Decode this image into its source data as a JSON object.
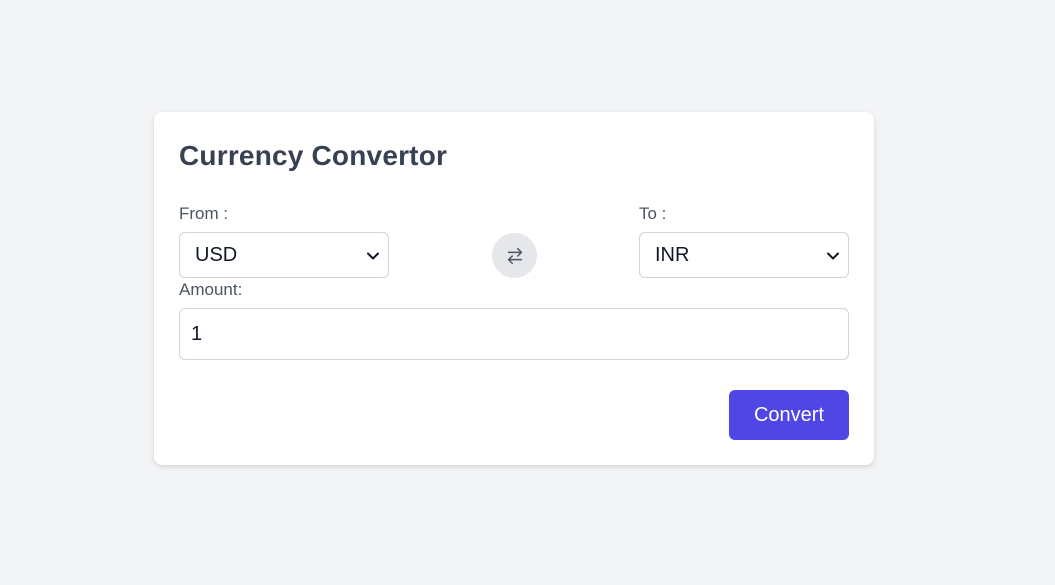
{
  "converter": {
    "title": "Currency Convertor",
    "from_label": "From :",
    "from_value": "USD",
    "to_label": "To :",
    "to_value": "INR",
    "amount_label": "Amount:",
    "amount_value": "1",
    "convert_label": "Convert",
    "swap_icon": "swap-arrows-icon",
    "accent_color": "#4f46e5"
  }
}
